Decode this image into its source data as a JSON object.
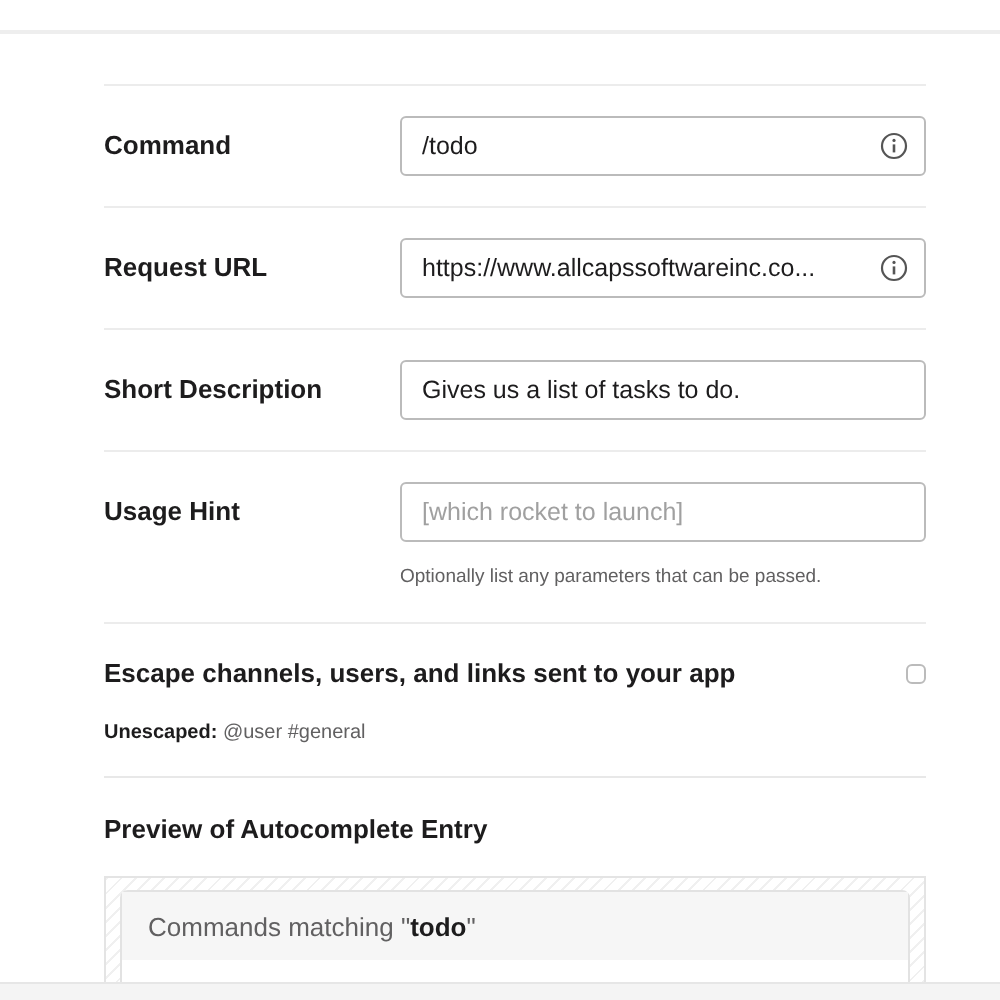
{
  "fields": [
    {
      "label": "Command",
      "value": "/todo",
      "info": true
    },
    {
      "label": "Request URL",
      "value": "https://www.allcapssoftwareinc.co...",
      "info": true
    },
    {
      "label": "Short Description",
      "value": "Gives us a list of tasks to do.",
      "info": false
    },
    {
      "label": "Usage Hint",
      "placeholder": "[which rocket to launch]",
      "help": "Optionally list any parameters that can be passed.",
      "info": false
    }
  ],
  "escape": {
    "label": "Escape channels, users, and links sent to your app",
    "checked": false,
    "note": "**Unescaped:** @user #general"
  },
  "preview": {
    "title": "Preview of Autocomplete Entry",
    "header": "Commands matching \"**todo**\""
  }
}
